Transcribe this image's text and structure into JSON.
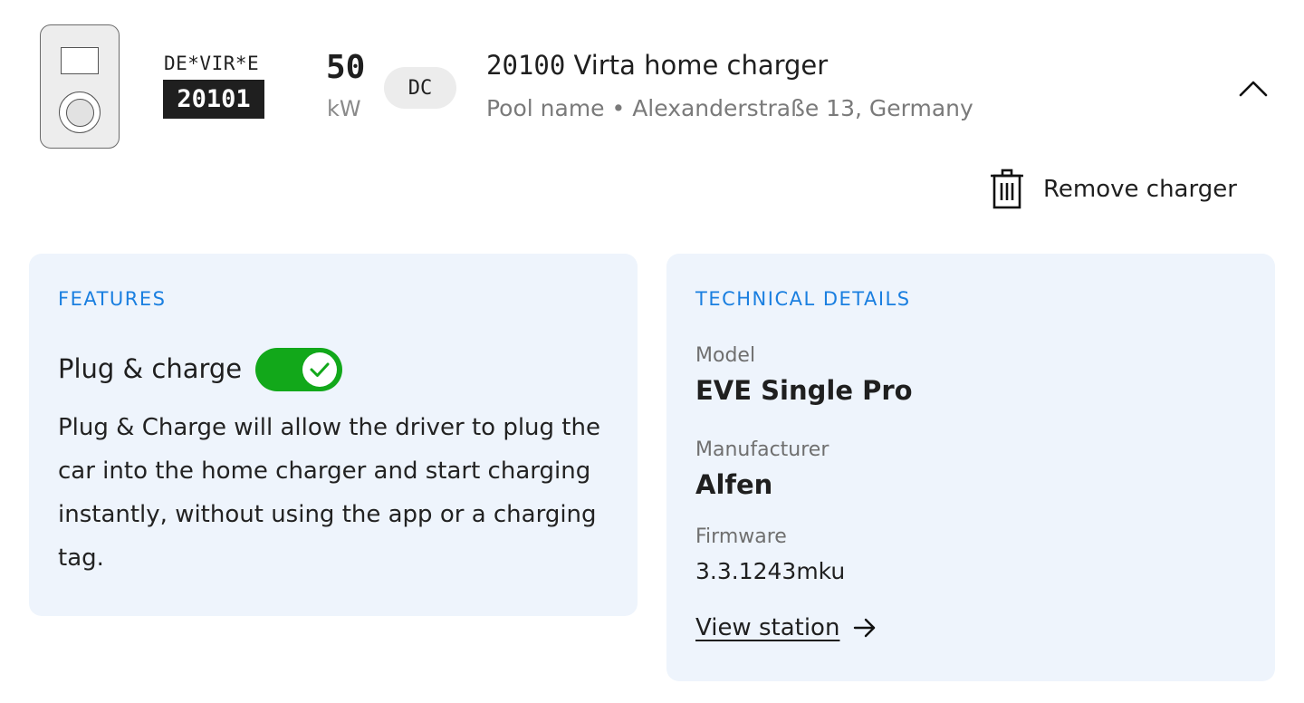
{
  "charger": {
    "evse_prefix": "DE*VIR*E",
    "evse_number": "20101",
    "power_value": "50",
    "power_unit": "kW",
    "current_type": "DC",
    "title_id": "20100",
    "title_name": "Virta home charger",
    "subtitle": "Pool name • Alexanderstraße 13,  Germany",
    "collapse_icon": "chevron-up-icon"
  },
  "actions": {
    "remove_label": "Remove charger",
    "remove_icon": "trash-icon"
  },
  "features": {
    "heading": "FEATURES",
    "items": [
      {
        "name": "Plug & charge",
        "enabled": true,
        "description": "Plug & Charge will allow the driver to plug the car into the home charger and start charging instantly, without using the app or a charging tag."
      }
    ]
  },
  "technical": {
    "heading": "TECHNICAL DETAILS",
    "model_label": "Model",
    "model_value": "EVE Single Pro",
    "manufacturer_label": "Manufacturer",
    "manufacturer_value": "Alfen",
    "firmware_label": "Firmware",
    "firmware_value": "3.3.1243mku",
    "view_link": "View station",
    "view_icon": "arrow-right-icon"
  },
  "colors": {
    "accent_blue": "#1a7fe0",
    "toggle_on": "#12a81a",
    "card_background": "#eef4fc"
  }
}
